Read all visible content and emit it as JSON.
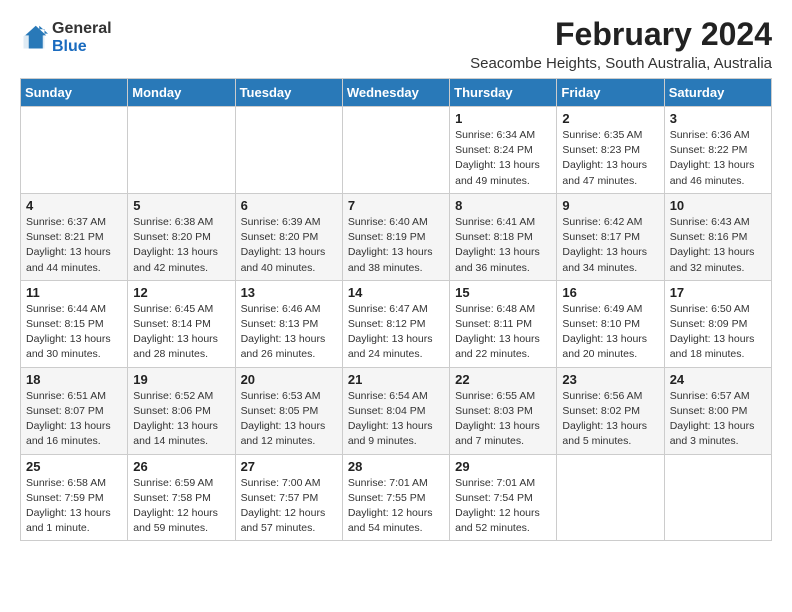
{
  "header": {
    "logo_general": "General",
    "logo_blue": "Blue",
    "main_title": "February 2024",
    "subtitle": "Seacombe Heights, South Australia, Australia"
  },
  "days_of_week": [
    "Sunday",
    "Monday",
    "Tuesday",
    "Wednesday",
    "Thursday",
    "Friday",
    "Saturday"
  ],
  "weeks": [
    [
      {
        "day": "",
        "info": ""
      },
      {
        "day": "",
        "info": ""
      },
      {
        "day": "",
        "info": ""
      },
      {
        "day": "",
        "info": ""
      },
      {
        "day": "1",
        "info": "Sunrise: 6:34 AM\nSunset: 8:24 PM\nDaylight: 13 hours\nand 49 minutes."
      },
      {
        "day": "2",
        "info": "Sunrise: 6:35 AM\nSunset: 8:23 PM\nDaylight: 13 hours\nand 47 minutes."
      },
      {
        "day": "3",
        "info": "Sunrise: 6:36 AM\nSunset: 8:22 PM\nDaylight: 13 hours\nand 46 minutes."
      }
    ],
    [
      {
        "day": "4",
        "info": "Sunrise: 6:37 AM\nSunset: 8:21 PM\nDaylight: 13 hours\nand 44 minutes."
      },
      {
        "day": "5",
        "info": "Sunrise: 6:38 AM\nSunset: 8:20 PM\nDaylight: 13 hours\nand 42 minutes."
      },
      {
        "day": "6",
        "info": "Sunrise: 6:39 AM\nSunset: 8:20 PM\nDaylight: 13 hours\nand 40 minutes."
      },
      {
        "day": "7",
        "info": "Sunrise: 6:40 AM\nSunset: 8:19 PM\nDaylight: 13 hours\nand 38 minutes."
      },
      {
        "day": "8",
        "info": "Sunrise: 6:41 AM\nSunset: 8:18 PM\nDaylight: 13 hours\nand 36 minutes."
      },
      {
        "day": "9",
        "info": "Sunrise: 6:42 AM\nSunset: 8:17 PM\nDaylight: 13 hours\nand 34 minutes."
      },
      {
        "day": "10",
        "info": "Sunrise: 6:43 AM\nSunset: 8:16 PM\nDaylight: 13 hours\nand 32 minutes."
      }
    ],
    [
      {
        "day": "11",
        "info": "Sunrise: 6:44 AM\nSunset: 8:15 PM\nDaylight: 13 hours\nand 30 minutes."
      },
      {
        "day": "12",
        "info": "Sunrise: 6:45 AM\nSunset: 8:14 PM\nDaylight: 13 hours\nand 28 minutes."
      },
      {
        "day": "13",
        "info": "Sunrise: 6:46 AM\nSunset: 8:13 PM\nDaylight: 13 hours\nand 26 minutes."
      },
      {
        "day": "14",
        "info": "Sunrise: 6:47 AM\nSunset: 8:12 PM\nDaylight: 13 hours\nand 24 minutes."
      },
      {
        "day": "15",
        "info": "Sunrise: 6:48 AM\nSunset: 8:11 PM\nDaylight: 13 hours\nand 22 minutes."
      },
      {
        "day": "16",
        "info": "Sunrise: 6:49 AM\nSunset: 8:10 PM\nDaylight: 13 hours\nand 20 minutes."
      },
      {
        "day": "17",
        "info": "Sunrise: 6:50 AM\nSunset: 8:09 PM\nDaylight: 13 hours\nand 18 minutes."
      }
    ],
    [
      {
        "day": "18",
        "info": "Sunrise: 6:51 AM\nSunset: 8:07 PM\nDaylight: 13 hours\nand 16 minutes."
      },
      {
        "day": "19",
        "info": "Sunrise: 6:52 AM\nSunset: 8:06 PM\nDaylight: 13 hours\nand 14 minutes."
      },
      {
        "day": "20",
        "info": "Sunrise: 6:53 AM\nSunset: 8:05 PM\nDaylight: 13 hours\nand 12 minutes."
      },
      {
        "day": "21",
        "info": "Sunrise: 6:54 AM\nSunset: 8:04 PM\nDaylight: 13 hours\nand 9 minutes."
      },
      {
        "day": "22",
        "info": "Sunrise: 6:55 AM\nSunset: 8:03 PM\nDaylight: 13 hours\nand 7 minutes."
      },
      {
        "day": "23",
        "info": "Sunrise: 6:56 AM\nSunset: 8:02 PM\nDaylight: 13 hours\nand 5 minutes."
      },
      {
        "day": "24",
        "info": "Sunrise: 6:57 AM\nSunset: 8:00 PM\nDaylight: 13 hours\nand 3 minutes."
      }
    ],
    [
      {
        "day": "25",
        "info": "Sunrise: 6:58 AM\nSunset: 7:59 PM\nDaylight: 13 hours\nand 1 minute."
      },
      {
        "day": "26",
        "info": "Sunrise: 6:59 AM\nSunset: 7:58 PM\nDaylight: 12 hours\nand 59 minutes."
      },
      {
        "day": "27",
        "info": "Sunrise: 7:00 AM\nSunset: 7:57 PM\nDaylight: 12 hours\nand 57 minutes."
      },
      {
        "day": "28",
        "info": "Sunrise: 7:01 AM\nSunset: 7:55 PM\nDaylight: 12 hours\nand 54 minutes."
      },
      {
        "day": "29",
        "info": "Sunrise: 7:01 AM\nSunset: 7:54 PM\nDaylight: 12 hours\nand 52 minutes."
      },
      {
        "day": "",
        "info": ""
      },
      {
        "day": "",
        "info": ""
      }
    ]
  ]
}
